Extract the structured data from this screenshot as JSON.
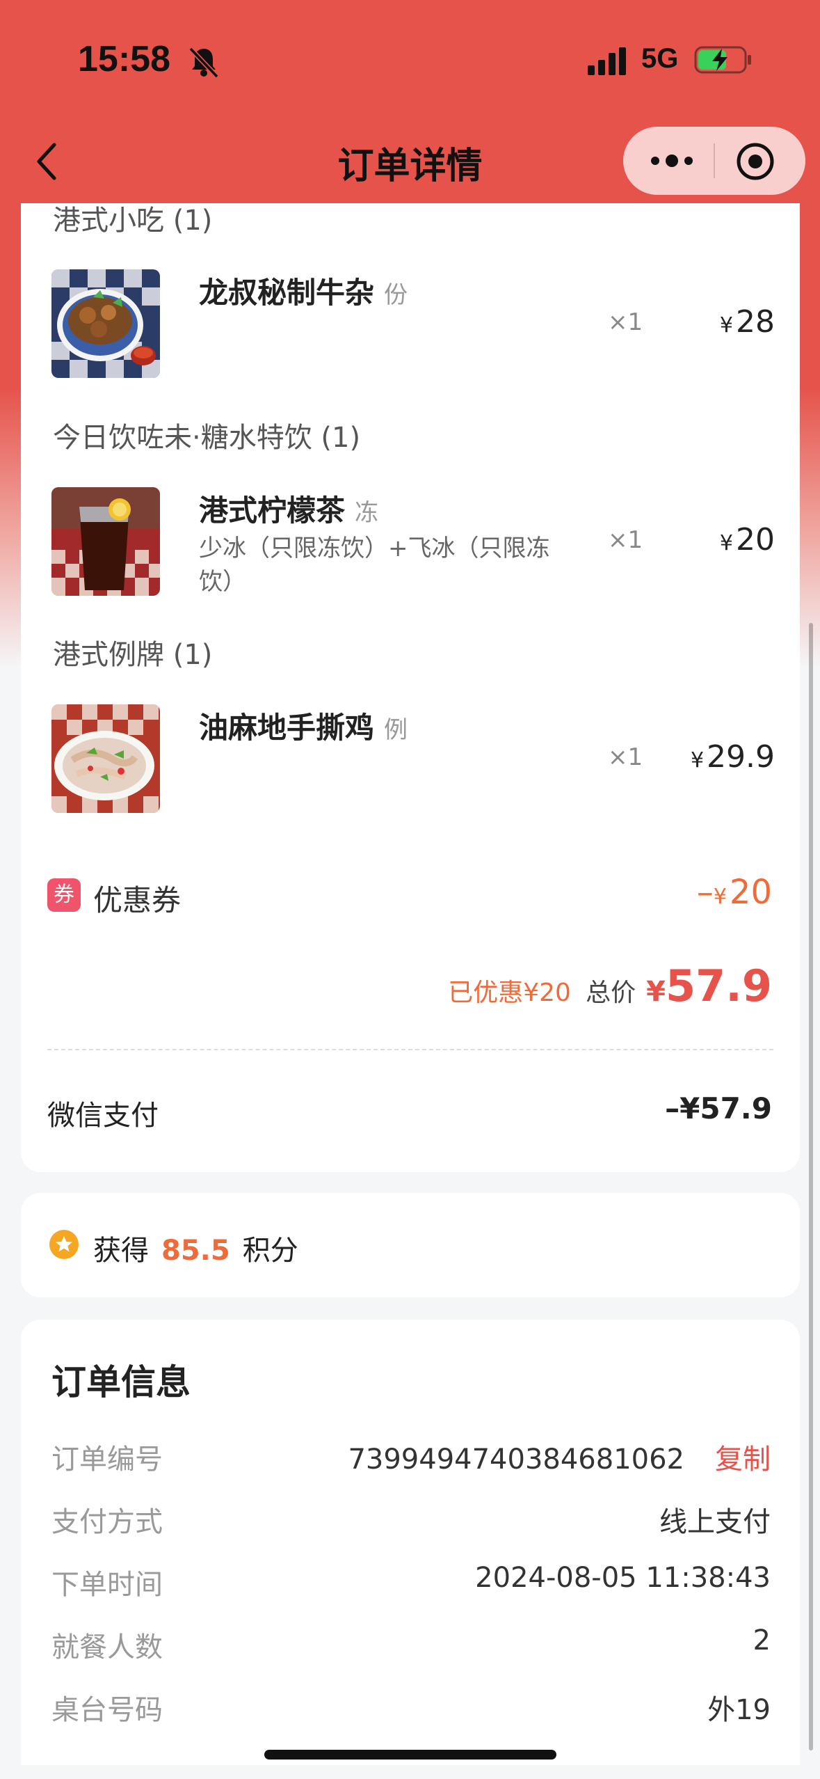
{
  "status_bar": {
    "time": "15:58",
    "network": "5G",
    "icons": [
      "bell-slash-icon",
      "signal-icon",
      "battery-charging-icon"
    ]
  },
  "nav": {
    "title": "订单详情",
    "icons": [
      "back-arrow-icon",
      "more-dots-icon",
      "target-icon"
    ]
  },
  "order": {
    "groups": [
      {
        "title": "港式小吃 (1)",
        "items": [
          {
            "name": "龙叔秘制牛杂",
            "unit": "份",
            "spec": "",
            "qty": "×1",
            "currency": "¥",
            "price": "28"
          }
        ]
      },
      {
        "title": "今日饮咗未·糖水特饮 (1)",
        "items": [
          {
            "name": "港式柠檬茶",
            "unit": "冻",
            "spec": "少冰（只限冻饮）+飞冰（只限冻饮）",
            "qty": "×1",
            "currency": "¥",
            "price": "20"
          }
        ]
      },
      {
        "title": "港式例牌 (1)",
        "items": [
          {
            "name": "油麻地手撕鸡",
            "unit": "例",
            "spec": "",
            "qty": "×1",
            "currency": "¥",
            "price": "29.9"
          }
        ]
      }
    ],
    "coupon": {
      "badge": "券",
      "label": "优惠券",
      "prefix": "–",
      "currency": "¥",
      "amount": "20"
    },
    "summary": {
      "saved": "已优惠¥20",
      "total_label": "总价",
      "currency": "¥",
      "total": "57.9"
    },
    "payment": {
      "label": "微信支付",
      "value": "–¥57.9"
    }
  },
  "points": {
    "prefix": "获得",
    "value": "85.5",
    "suffix": "积分"
  },
  "info": {
    "title": "订单信息",
    "rows": [
      {
        "label": "订单编号",
        "value": "7399494740384681062",
        "action": "复制"
      },
      {
        "label": "支付方式",
        "value": "线上支付"
      },
      {
        "label": "下单时间",
        "value": "2024-08-05 11:38:43"
      },
      {
        "label": "就餐人数",
        "value": "2"
      },
      {
        "label": "桌台号码",
        "value": "外19"
      }
    ]
  },
  "colors": {
    "brand": "#e5534b",
    "accent": "#ef6b3a",
    "coupon_badge": "#f0546b",
    "points_icon": "#f5a623"
  }
}
